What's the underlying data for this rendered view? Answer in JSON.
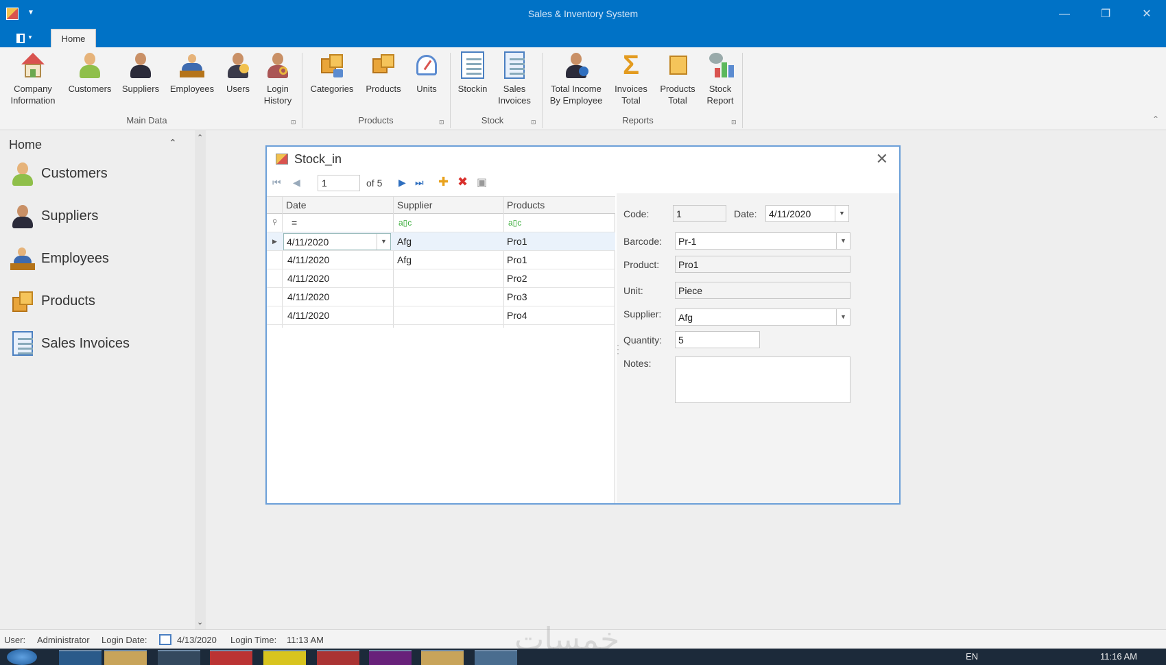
{
  "window": {
    "title": "Sales & Inventory System",
    "minimize": "—",
    "restore": "❐",
    "close": "✕"
  },
  "tabs": {
    "file": "",
    "home": "Home"
  },
  "ribbon": {
    "main_data": {
      "label": "Main Data",
      "buttons": [
        "Company\nInformation",
        "Customers",
        "Suppliers",
        "Employees",
        "Users",
        "Login\nHistory"
      ]
    },
    "products": {
      "label": "Products",
      "buttons": [
        "Categories",
        "Products",
        "Units"
      ]
    },
    "stock": {
      "label": "Stock",
      "buttons": [
        "Stockin",
        "Sales\nInvoices"
      ]
    },
    "reports": {
      "label": "Reports",
      "buttons": [
        "Total Income\nBy Employee",
        "Invoices\nTotal",
        "Products\nTotal",
        "Stock\nReport"
      ]
    },
    "launcher": "⊡",
    "collapse": "⌃"
  },
  "sidebar": {
    "header": "Home",
    "items": [
      "Customers",
      "Suppliers",
      "Employees",
      "Products",
      "Sales Invoices"
    ]
  },
  "dialog": {
    "title": "Stock_in",
    "navigator": {
      "current": "1",
      "of": "of 5"
    },
    "grid": {
      "columns": [
        "Date",
        "Supplier",
        "Products"
      ],
      "filter_equals": "=",
      "filter_contains": "a▯c",
      "rows": [
        {
          "date": "4/11/2020",
          "supplier": "Afg",
          "product": "Pro1"
        },
        {
          "date": "4/11/2020",
          "supplier": "Afg",
          "product": "Pro1"
        },
        {
          "date": "4/11/2020",
          "supplier": "",
          "product": "Pro2"
        },
        {
          "date": "4/11/2020",
          "supplier": "",
          "product": "Pro3"
        },
        {
          "date": "4/11/2020",
          "supplier": "",
          "product": "Pro4"
        }
      ]
    },
    "form": {
      "code_label": "Code:",
      "code": "1",
      "date_label": "Date:",
      "date": "4/11/2020",
      "barcode_label": "Barcode:",
      "barcode": "Pr-1",
      "product_label": "Product:",
      "product": "Pro1",
      "unit_label": "Unit:",
      "unit": "Piece",
      "supplier_label": "Supplier:",
      "supplier": "Afg",
      "quantity_label": "Quantity:",
      "quantity": "5",
      "notes_label": "Notes:",
      "notes": ""
    }
  },
  "statusbar": {
    "user_label": "User:",
    "user": "Administrator",
    "login_date_label": "Login Date:",
    "login_date": "4/13/2020",
    "login_time_label": "Login Time:",
    "login_time": "11:13 AM"
  },
  "watermark": "خمسات",
  "taskbar": {
    "lang": "EN",
    "clock": "11:16 AM"
  },
  "colors": {
    "titlebar": "#0072c6",
    "accent_border": "#6b9fd8"
  }
}
